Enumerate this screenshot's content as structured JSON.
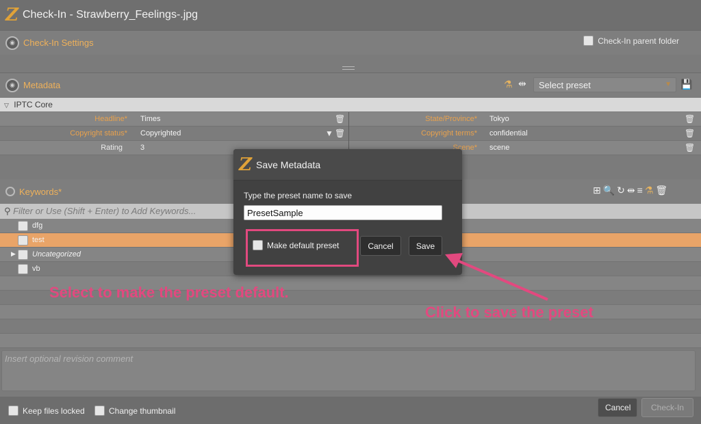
{
  "window": {
    "title": "Check-In - Strawberry_Feelings-.jpg",
    "logo": "Z"
  },
  "checkin_settings": {
    "title": "Check-In Settings",
    "parent_folder_label": "Check-In parent folder"
  },
  "metadata": {
    "title": "Metadata",
    "preset_placeholder": "Select preset",
    "group": "IPTC Core",
    "rows": [
      {
        "left_label": "Headline",
        "left_required": "*",
        "left_value": "Times",
        "right_label": "State/Province",
        "right_required": "*",
        "right_value": "Tokyo"
      },
      {
        "left_label": "Copyright status",
        "left_required": "*",
        "left_value": "Copyrighted",
        "right_label": "Copyright terms",
        "right_required": "*",
        "right_value": "confidential"
      },
      {
        "left_label": "Rating",
        "left_required": "",
        "left_value": "3",
        "right_label": "Scene",
        "right_required": "*",
        "right_value": "scene"
      }
    ]
  },
  "keywords": {
    "title": "Keywords*",
    "filter_placeholder": "Filter or Use (Shift + Enter) to Add Keywords...",
    "items": [
      {
        "label": "dfg",
        "selected": false
      },
      {
        "label": "test",
        "selected": true
      },
      {
        "label": "Uncategorized",
        "selected": false
      },
      {
        "label": "vb",
        "selected": false
      }
    ]
  },
  "comment_placeholder": "Insert optional revision comment",
  "footer": {
    "keep_locked": "Keep files locked",
    "change_thumbnail": "Change thumbnail",
    "cancel": "Cancel",
    "checkin": "Check-In"
  },
  "dialog": {
    "title": "Save Metadata",
    "prompt": "Type the preset name to save",
    "preset_name": "PresetSample",
    "default_label": "Make default preset",
    "cancel": "Cancel",
    "save": "Save"
  },
  "annotations": {
    "default_note": "Select to make the preset default.",
    "save_note": "Click to save the preset",
    "color": "#e2497f"
  },
  "colors": {
    "accent": "#efb15a",
    "selected_row": "#e9a468"
  }
}
